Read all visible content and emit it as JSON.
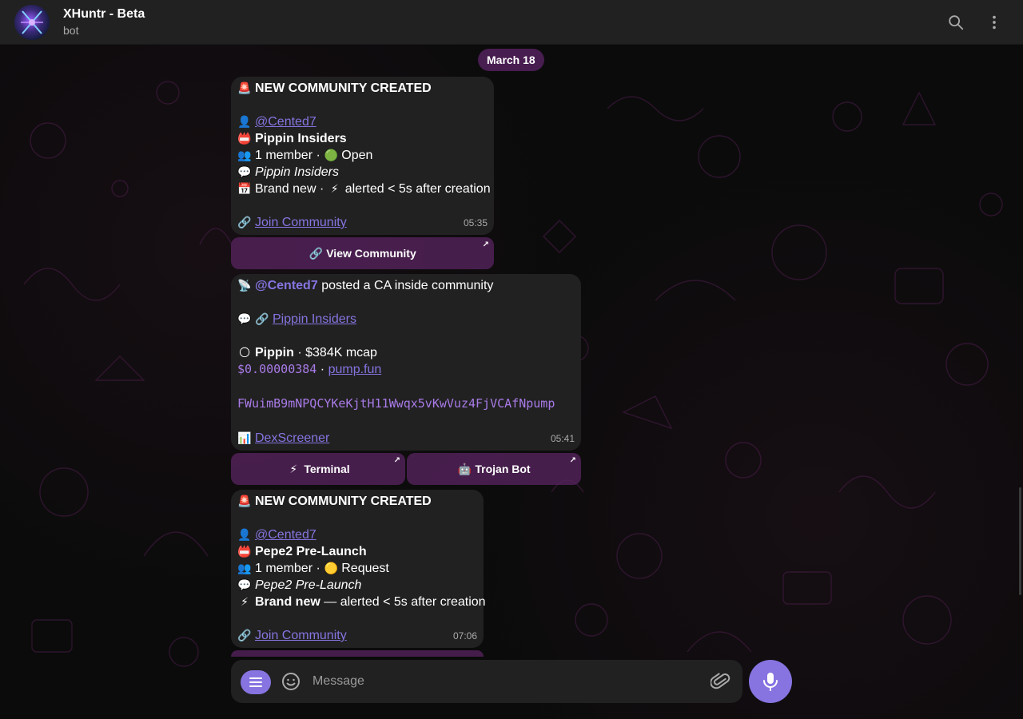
{
  "header": {
    "title": "XHuntr - Beta",
    "subtitle": "bot"
  },
  "date_chip": "March 18",
  "messages": [
    {
      "lines": {
        "heading_emoji": "🚨",
        "heading": "NEW COMMUNITY CREATED",
        "user_emoji": "👤",
        "user": "@Cented7",
        "name_emoji": "📛",
        "name": "Pippin Insiders",
        "members_emoji": "👥",
        "members": "1 member ·",
        "status_emoji": "🟢",
        "status": "Open",
        "desc_emoji": "💬",
        "desc": "Pippin Insiders",
        "age_emoji": "📅",
        "age": "Brand new ·",
        "alert_emoji": "⚡",
        "alert": "alerted < 5s after creation",
        "join_emoji": "🔗",
        "join": "Join Community"
      },
      "time": "05:35",
      "button": {
        "emoji": "🔗",
        "label": "View Community"
      }
    },
    {
      "lines": {
        "head_emoji": "📡",
        "head_user": "@Cented7",
        "head_text": "posted a CA inside community",
        "comm_emoji": "💬",
        "comm_link_emoji": "🔗",
        "comm": "Pippin Insiders",
        "token_emoji": "🌕",
        "token": "Pippin",
        "mcap": "·  $384K mcap",
        "price": "$0.00000384",
        "sep": "·",
        "platform": "pump.fun",
        "ca": "FWuimB9mNPQCYKeKjtH11Wwqx5vKwVuz4FjVCAfNpump",
        "dex_emoji": "📊",
        "dex": "DexScreener"
      },
      "time": "05:41",
      "buttons": [
        {
          "emoji": "⚡",
          "label": "Terminal"
        },
        {
          "emoji": "🤖",
          "label": "Trojan Bot"
        }
      ]
    },
    {
      "lines": {
        "heading_emoji": "🚨",
        "heading": "NEW COMMUNITY CREATED",
        "user_emoji": "👤",
        "user": "@Cented7",
        "name_emoji": "📛",
        "name": "Pepe2 Pre-Launch",
        "members_emoji": "👥",
        "members": "1 member ·",
        "status_emoji": "🟡",
        "status": "Request",
        "desc_emoji": "💬",
        "desc": "Pepe2 Pre-Launch",
        "age_emoji": "⚡",
        "age": "Brand new",
        "alert": "— alerted < 5s after creation",
        "join_emoji": "🔗",
        "join": "Join Community"
      },
      "time": "07:06"
    }
  ],
  "composer": {
    "placeholder": "Message"
  },
  "icons": {
    "search": "search-icon",
    "more": "more-vertical-icon",
    "menu": "menu-icon",
    "emoji": "smile-icon",
    "attach": "paperclip-icon",
    "mic": "microphone-icon"
  },
  "colors": {
    "accent": "#8774e1",
    "bubble": "#212121",
    "button": "#5a2462",
    "header": "#212121"
  }
}
